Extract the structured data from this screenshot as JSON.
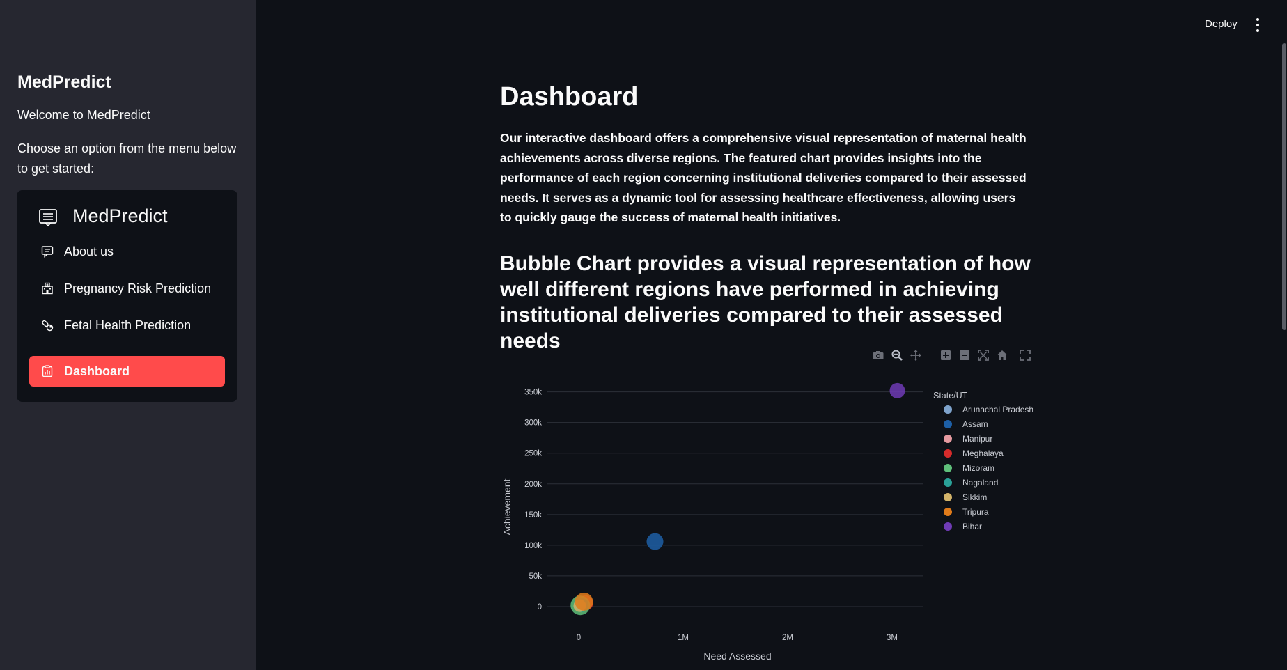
{
  "sidebar": {
    "title": "MedPredict",
    "welcome": "Welcome to MedPredict",
    "choose": "Choose an option from the menu below to get started:",
    "menu": {
      "title": "MedPredict",
      "items": [
        {
          "label": "About us",
          "icon": "chat-icon"
        },
        {
          "label": "Pregnancy Risk Prediction",
          "icon": "hospital-icon"
        },
        {
          "label": "Fetal Health Prediction",
          "icon": "capsule-icon"
        },
        {
          "label": "Dashboard",
          "icon": "clipboard-data-icon",
          "active": true
        }
      ]
    }
  },
  "topbar": {
    "deploy_label": "Deploy"
  },
  "main": {
    "title": "Dashboard",
    "intro": "Our interactive dashboard offers a comprehensive visual representation of maternal health achievements across diverse regions. The featured chart provides insights into the performance of each region concerning institutional deliveries compared to their assessed needs. It serves as a dynamic tool for assessing healthcare effectiveness, allowing users to quickly gauge the success of maternal health initiatives.",
    "subhead": "Bubble Chart provides a visual representation of how well different regions have performed in achieving institutional deliveries compared to their assessed needs"
  },
  "modebar": [
    "camera-icon",
    "zoom-icon",
    "pan-icon",
    "zoom-in-icon",
    "zoom-out-icon",
    "autoscale-icon",
    "home-icon",
    "fullscreen-icon"
  ],
  "chart_data": {
    "type": "scatter",
    "xlabel": "Need Assessed",
    "ylabel": "Achievement",
    "xlim": [
      -300000,
      3300000
    ],
    "ylim": [
      -25000,
      370000
    ],
    "xticks": [
      {
        "v": 0,
        "label": "0"
      },
      {
        "v": 1000000,
        "label": "1M"
      },
      {
        "v": 2000000,
        "label": "2M"
      },
      {
        "v": 3000000,
        "label": "3M"
      }
    ],
    "yticks": [
      {
        "v": 0,
        "label": "0"
      },
      {
        "v": 50000,
        "label": "50k"
      },
      {
        "v": 100000,
        "label": "100k"
      },
      {
        "v": 150000,
        "label": "150k"
      },
      {
        "v": 200000,
        "label": "200k"
      },
      {
        "v": 250000,
        "label": "250k"
      },
      {
        "v": 300000,
        "label": "300k"
      },
      {
        "v": 350000,
        "label": "350k"
      }
    ],
    "grid": true,
    "legend_title": "State/UT",
    "legend_position": "right",
    "series": [
      {
        "name": "Arunachal Pradesh",
        "color": "#7ea3cc",
        "x": 25000,
        "y": 3000,
        "r": 9
      },
      {
        "name": "Assam",
        "color": "#1d5fa6",
        "x": 730000,
        "y": 106000,
        "r": 12
      },
      {
        "name": "Manipur",
        "color": "#e59aa0",
        "x": 40000,
        "y": 4000,
        "r": 10
      },
      {
        "name": "Meghalaya",
        "color": "#d62b2b",
        "x": 65000,
        "y": 6000,
        "r": 11
      },
      {
        "name": "Mizoram",
        "color": "#5fbf7a",
        "x": 15000,
        "y": 2000,
        "r": 14
      },
      {
        "name": "Nagaland",
        "color": "#2aa198",
        "x": 30000,
        "y": 2500,
        "r": 10
      },
      {
        "name": "Sikkim",
        "color": "#d4b46a",
        "x": 10000,
        "y": 1500,
        "r": 9
      },
      {
        "name": "Tripura",
        "color": "#e07b1a",
        "x": 50000,
        "y": 8000,
        "r": 13
      },
      {
        "name": "Bihar",
        "color": "#6f3bb5",
        "x": 3050000,
        "y": 352000,
        "r": 11
      }
    ]
  }
}
